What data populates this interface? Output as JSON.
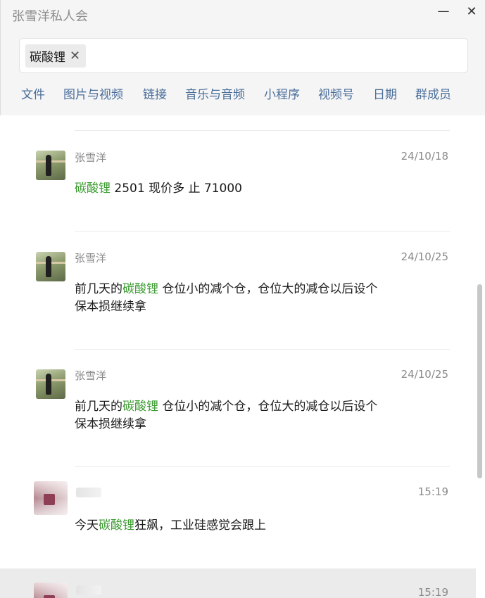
{
  "window": {
    "title": "张雪洋私人会",
    "minimize_glyph": "—",
    "close_glyph": "✕"
  },
  "search": {
    "chip_label": "碳酸锂",
    "chip_close_glyph": "✕"
  },
  "filters": [
    "文件",
    "图片与视频",
    "链接",
    "音乐与音频",
    "小程序",
    "视频号",
    "日期",
    "群成员"
  ],
  "colors": {
    "highlight": "#3a9a2f",
    "filter_link": "#496d9a"
  },
  "messages": [
    {
      "sender": "张雪洋",
      "time": "24/10/18",
      "before": "",
      "keyword": "碳酸锂",
      "after": " 2501  现价多 止 71000"
    },
    {
      "sender": "张雪洋",
      "time": "24/10/25",
      "before": "前几天的",
      "keyword": "碳酸锂",
      "after": " 仓位小的减个仓，仓位大的减仓以后设个保本损继续拿"
    },
    {
      "sender": "张雪洋",
      "time": "24/10/25",
      "before": "前几天的",
      "keyword": "碳酸锂",
      "after": " 仓位小的减个仓，仓位大的减仓以后设个保本损继续拿"
    },
    {
      "sender": "",
      "time": "15:19",
      "before": "今天",
      "keyword": "碳酸锂",
      "after": "狂飙，工业硅感觉会跟上"
    },
    {
      "sender": "",
      "time": "15:19"
    }
  ]
}
